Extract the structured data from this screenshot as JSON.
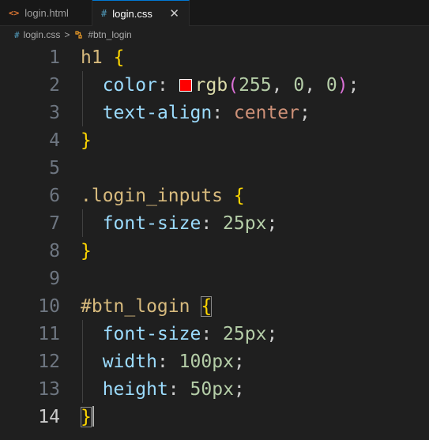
{
  "tabs": [
    {
      "icon": "<>",
      "label": "login.html",
      "active": false
    },
    {
      "icon": "#",
      "label": "login.css",
      "active": true,
      "close": "✕"
    }
  ],
  "breadcrumb": {
    "file_icon": "#",
    "file": "login.css",
    "separator": ">",
    "symbol": "#btn_login"
  },
  "lines": [
    {
      "n": "1"
    },
    {
      "n": "2"
    },
    {
      "n": "3"
    },
    {
      "n": "4"
    },
    {
      "n": "5"
    },
    {
      "n": "6"
    },
    {
      "n": "7"
    },
    {
      "n": "8"
    },
    {
      "n": "9"
    },
    {
      "n": "10"
    },
    {
      "n": "11"
    },
    {
      "n": "12"
    },
    {
      "n": "13"
    },
    {
      "n": "14"
    }
  ],
  "code": {
    "l1_selector": "h1",
    "open_brace": "{",
    "close_brace": "}",
    "l2_prop": "color",
    "colon": ":",
    "semicolon": ";",
    "comma": ",",
    "l2_fn": "rgb",
    "paren_open": "(",
    "paren_close": ")",
    "l2_r": "255",
    "l2_g": "0",
    "l2_b": "0",
    "l3_prop": "text-align",
    "l3_val": "center",
    "l6_selector": ".login_inputs",
    "l7_prop": "font-size",
    "l7_num": "25",
    "l7_unit": "px",
    "l10_selector": "#btn_login",
    "l11_prop": "font-size",
    "l11_num": "25",
    "l11_unit": "px",
    "l12_prop": "width",
    "l12_num": "100",
    "l12_unit": "px",
    "l13_prop": "height",
    "l13_num": "50",
    "l13_unit": "px"
  },
  "colors": {
    "swatch": "#ff0000",
    "accent": "#0078d4"
  },
  "current_line": 14
}
